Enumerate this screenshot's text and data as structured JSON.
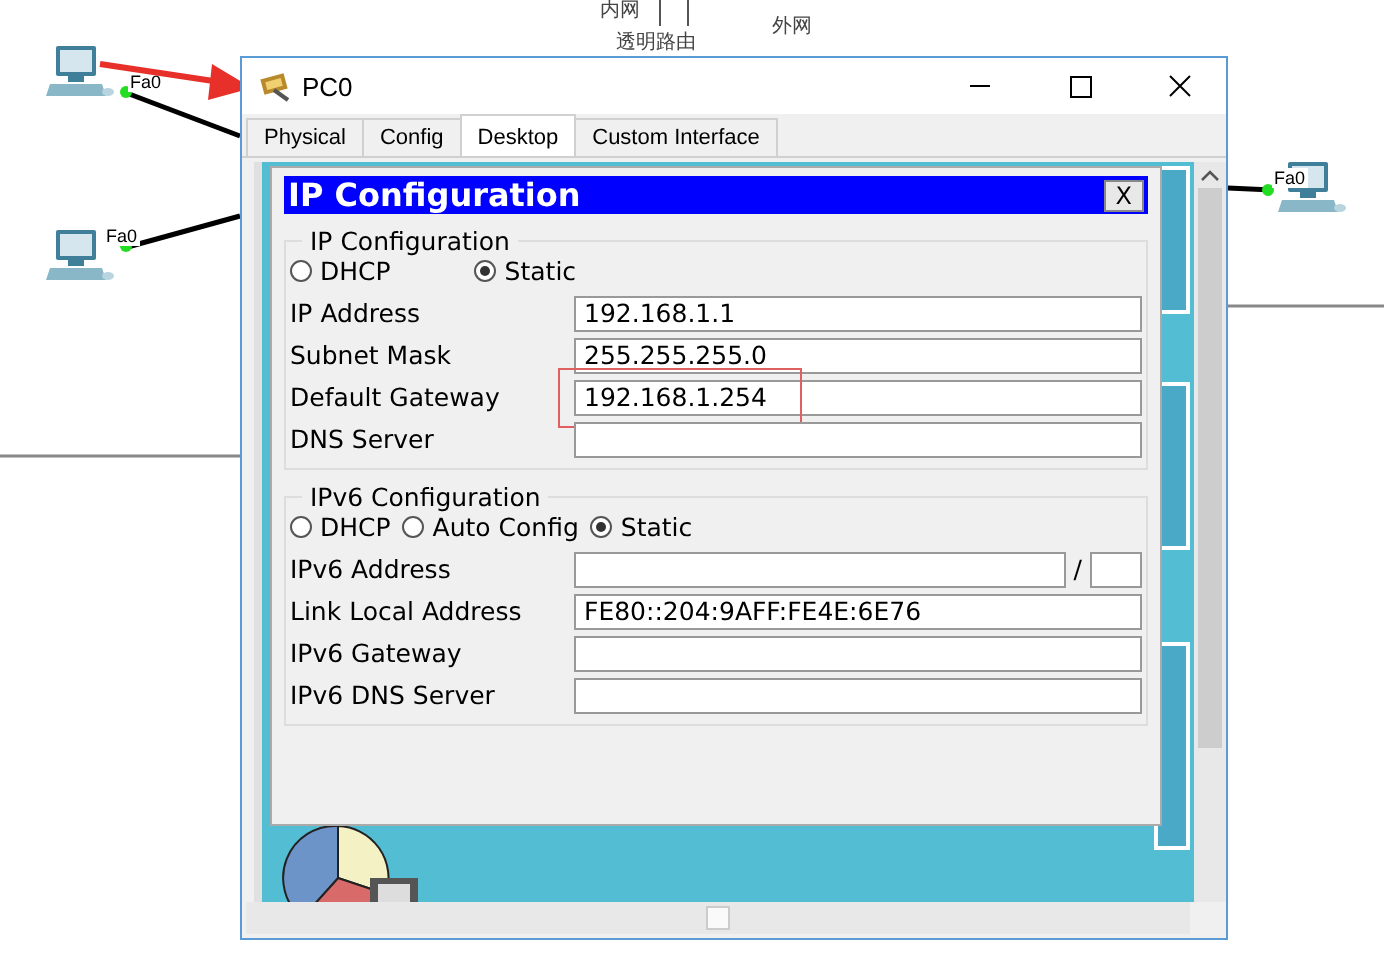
{
  "canvas": {
    "labels": [
      {
        "text": "内网"
      },
      {
        "text": "透明路由"
      },
      {
        "text": "外网"
      }
    ],
    "devices": [
      {
        "port": "Fa0"
      },
      {
        "port": "Fa0"
      },
      {
        "port": "Fa0"
      }
    ]
  },
  "window": {
    "title": "PC0",
    "tabs": [
      {
        "label": "Physical",
        "selected": false
      },
      {
        "label": "Config",
        "selected": false
      },
      {
        "label": "Desktop",
        "selected": true
      },
      {
        "label": "Custom Interface",
        "selected": false
      }
    ]
  },
  "ip_configuration": {
    "title": "IP Configuration",
    "close": "X",
    "ipv4": {
      "legend": "IP Configuration",
      "modes": [
        {
          "label": "DHCP",
          "selected": false
        },
        {
          "label": "Static",
          "selected": true
        }
      ],
      "fields": [
        {
          "label": "IP Address",
          "value": "192.168.1.1",
          "highlighted": false
        },
        {
          "label": "Subnet Mask",
          "value": "255.255.255.0",
          "highlighted": false
        },
        {
          "label": "Default Gateway",
          "value": "192.168.1.254",
          "highlighted": true
        },
        {
          "label": "DNS Server",
          "highlighted": false
        }
      ]
    },
    "ipv6": {
      "legend": "IPv6 Configuration",
      "modes": [
        {
          "label": "DHCP",
          "selected": false
        },
        {
          "label": "Auto Config",
          "selected": false
        },
        {
          "label": "Static",
          "selected": true
        }
      ],
      "fields": [
        {
          "label": "IPv6 Address",
          "separator": "/"
        },
        {
          "label": "Link Local Address",
          "value": "FE80::204:9AFF:FE4E:6E76"
        },
        {
          "label": "IPv6 Gateway"
        },
        {
          "label": "IPv6 DNS Server"
        }
      ]
    }
  }
}
